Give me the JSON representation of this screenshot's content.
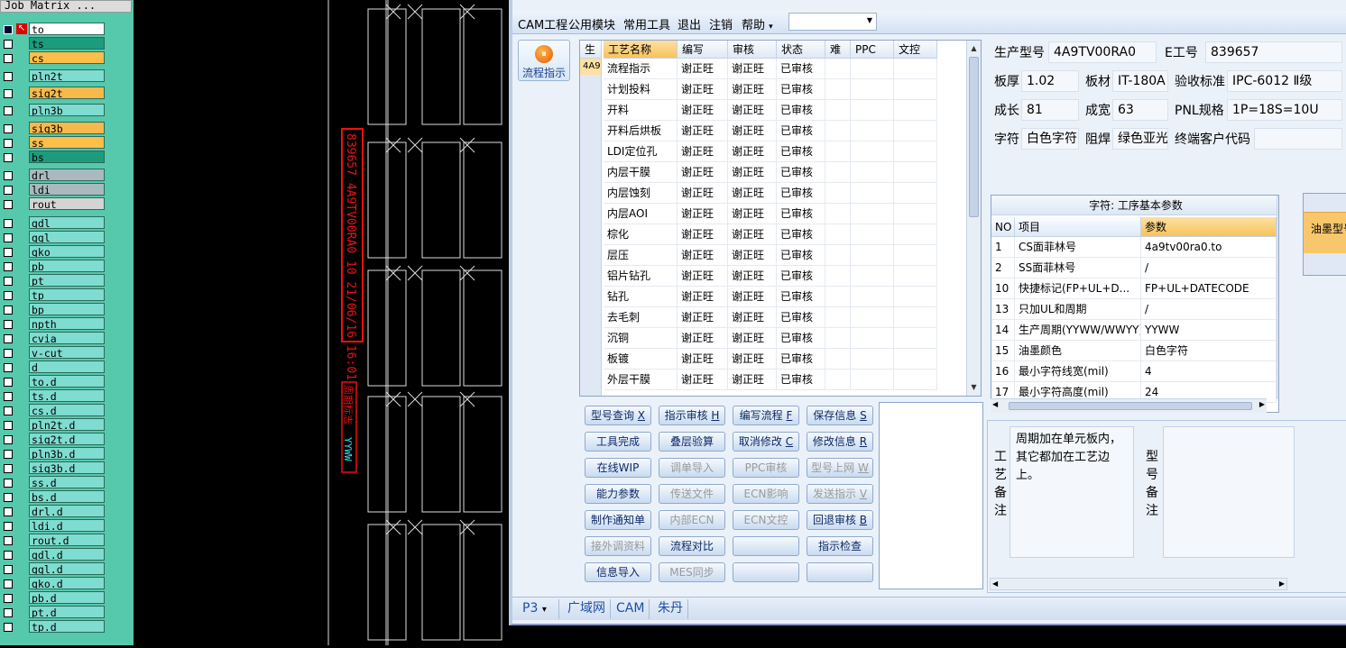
{
  "matrix": {
    "title": "Job Matrix ...",
    "layers": [
      {
        "name": "to",
        "kind": "to"
      },
      {
        "name": "ts",
        "kind": "bs"
      },
      {
        "name": "cs",
        "kind": "cs"
      },
      {
        "name": "pln2t",
        "kind": "misc"
      },
      {
        "name": "sig2t",
        "kind": "sig"
      },
      {
        "name": "pln3b",
        "kind": "misc"
      },
      {
        "name": "sig3b",
        "kind": "sig"
      },
      {
        "name": "ss",
        "kind": "cs"
      },
      {
        "name": "bs",
        "kind": "bs"
      },
      {
        "name": "drl",
        "kind": "drl"
      },
      {
        "name": "ldi",
        "kind": "drl"
      },
      {
        "name": "rout",
        "kind": "rout"
      },
      {
        "name": "gdl",
        "kind": "misc"
      },
      {
        "name": "ggl",
        "kind": "misc"
      },
      {
        "name": "gko",
        "kind": "misc"
      },
      {
        "name": "pb",
        "kind": "misc"
      },
      {
        "name": "pt",
        "kind": "misc"
      },
      {
        "name": "tp",
        "kind": "misc"
      },
      {
        "name": "bp",
        "kind": "misc"
      },
      {
        "name": "npth",
        "kind": "misc"
      },
      {
        "name": "cvia",
        "kind": "misc"
      },
      {
        "name": "v-cut",
        "kind": "misc"
      },
      {
        "name": "d",
        "kind": "misc"
      },
      {
        "name": "to.d",
        "kind": "misc"
      },
      {
        "name": "ts.d",
        "kind": "misc"
      },
      {
        "name": "cs.d",
        "kind": "misc"
      },
      {
        "name": "pln2t.d",
        "kind": "misc"
      },
      {
        "name": "sig2t.d",
        "kind": "misc"
      },
      {
        "name": "pln3b.d",
        "kind": "misc"
      },
      {
        "name": "sig3b.d",
        "kind": "misc"
      },
      {
        "name": "ss.d",
        "kind": "misc"
      },
      {
        "name": "bs.d",
        "kind": "misc"
      },
      {
        "name": "drl.d",
        "kind": "misc"
      },
      {
        "name": "ldi.d",
        "kind": "misc"
      },
      {
        "name": "rout.d",
        "kind": "misc"
      },
      {
        "name": "gdl.d",
        "kind": "misc"
      },
      {
        "name": "ggl.d",
        "kind": "misc"
      },
      {
        "name": "gko.d",
        "kind": "misc"
      },
      {
        "name": "pb.d",
        "kind": "misc"
      },
      {
        "name": "pt.d",
        "kind": "misc"
      },
      {
        "name": "tp.d",
        "kind": "misc"
      }
    ],
    "colors": {
      "misc": "#7fdcd0",
      "sig": "#f7b94b",
      "cs": "#fbbf4a",
      "bs": "#1c9c7c",
      "drl": "#a9b9bf",
      "rout": "#d4d4d4",
      "to": "#ffffff"
    }
  },
  "cad": {
    "code_text": "839657 4A9TV00RA0 10 21/06/16 16:01",
    "cyan_text": "YYWW",
    "red_label": "周期标志",
    "stroke": "#e11",
    "cyan": "#2ee8f4"
  },
  "menu": {
    "items": [
      "CAM工程",
      "公用模块",
      "常用工具",
      "退出",
      "注销",
      "帮助"
    ],
    "help_arrow": "▾",
    "combo_value": ""
  },
  "flow_button": {
    "label": "流程指示"
  },
  "process_grid": {
    "left_header": "生",
    "left_cell": "4A9",
    "columns": [
      "工艺名称",
      "编写",
      "审核",
      "状态",
      "难",
      "PPC",
      "文控"
    ],
    "rows": [
      [
        "流程指示",
        "谢正旺",
        "谢正旺",
        "已审核",
        "",
        "",
        ""
      ],
      [
        "计划投料",
        "谢正旺",
        "谢正旺",
        "已审核",
        "",
        "",
        ""
      ],
      [
        "开料",
        "谢正旺",
        "谢正旺",
        "已审核",
        "",
        "",
        ""
      ],
      [
        "开料后烘板",
        "谢正旺",
        "谢正旺",
        "已审核",
        "",
        "",
        ""
      ],
      [
        "LDI定位孔",
        "谢正旺",
        "谢正旺",
        "已审核",
        "",
        "",
        ""
      ],
      [
        "内层干膜",
        "谢正旺",
        "谢正旺",
        "已审核",
        "",
        "",
        ""
      ],
      [
        "内层蚀刻",
        "谢正旺",
        "谢正旺",
        "已审核",
        "",
        "",
        ""
      ],
      [
        "内层AOI",
        "谢正旺",
        "谢正旺",
        "已审核",
        "",
        "",
        ""
      ],
      [
        "棕化",
        "谢正旺",
        "谢正旺",
        "已审核",
        "",
        "",
        ""
      ],
      [
        "层压",
        "谢正旺",
        "谢正旺",
        "已审核",
        "",
        "",
        ""
      ],
      [
        "铝片钻孔",
        "谢正旺",
        "谢正旺",
        "已审核",
        "",
        "",
        ""
      ],
      [
        "钻孔",
        "谢正旺",
        "谢正旺",
        "已审核",
        "",
        "",
        ""
      ],
      [
        "去毛刺",
        "谢正旺",
        "谢正旺",
        "已审核",
        "",
        "",
        ""
      ],
      [
        "沉铜",
        "谢正旺",
        "谢正旺",
        "已审核",
        "",
        "",
        ""
      ],
      [
        "板镀",
        "谢正旺",
        "谢正旺",
        "已审核",
        "",
        "",
        ""
      ],
      [
        "外层干膜",
        "谢正旺",
        "谢正旺",
        "已审核",
        "",
        "",
        ""
      ]
    ]
  },
  "buttons": [
    [
      {
        "label": "型号查询",
        "key": "X",
        "enabled": true
      },
      {
        "label": "指示审核",
        "key": "H",
        "enabled": true
      },
      {
        "label": "编写流程",
        "key": "F",
        "enabled": true
      },
      {
        "label": "保存信息",
        "key": "S",
        "enabled": true
      }
    ],
    [
      {
        "label": "工具完成",
        "key": "",
        "enabled": true
      },
      {
        "label": "叠层验算",
        "key": "",
        "enabled": true
      },
      {
        "label": "取消修改",
        "key": "C",
        "enabled": true
      },
      {
        "label": "修改信息",
        "key": "R",
        "enabled": true
      }
    ],
    [
      {
        "label": "在线WIP",
        "key": "",
        "enabled": true
      },
      {
        "label": "调单导入",
        "key": "",
        "enabled": false
      },
      {
        "label": "PPC审核",
        "key": "",
        "enabled": false
      },
      {
        "label": "型号上网",
        "key": "W",
        "enabled": false
      }
    ],
    [
      {
        "label": "能力参数",
        "key": "",
        "enabled": true
      },
      {
        "label": "传送文件",
        "key": "",
        "enabled": false
      },
      {
        "label": "ECN影响",
        "key": "",
        "enabled": false
      },
      {
        "label": "发送指示",
        "key": "V",
        "enabled": false
      }
    ],
    [
      {
        "label": "制作通知单",
        "key": "",
        "enabled": true
      },
      {
        "label": "内部ECN",
        "key": "",
        "enabled": false
      },
      {
        "label": "ECN文控",
        "key": "",
        "enabled": false
      },
      {
        "label": "回退审核",
        "key": "B",
        "enabled": true
      }
    ],
    [
      {
        "label": "接外调资料",
        "key": "",
        "enabled": false
      },
      {
        "label": "流程对比",
        "key": "",
        "enabled": true
      },
      {
        "label": "",
        "key": "",
        "enabled": true
      },
      {
        "label": "指示检查",
        "key": "",
        "enabled": true
      }
    ],
    [
      {
        "label": "信息导入",
        "key": "",
        "enabled": true
      },
      {
        "label": "MES同步",
        "key": "",
        "enabled": false
      },
      {
        "label": "",
        "key": "",
        "enabled": true
      },
      {
        "label": "",
        "key": "",
        "enabled": true
      }
    ]
  ],
  "info": {
    "part_no_label": "生产型号",
    "part_no": "4A9TV00RA0",
    "e_no_label": "E工号",
    "e_no": "839657",
    "thickness_label": "板厚",
    "thickness": "1.02",
    "material_label": "板材",
    "material": "IT-180A",
    "standard_label": "验收标准",
    "standard": "IPC-6012 Ⅱ级",
    "length_label": "成长",
    "length": "81",
    "width_label": "成宽",
    "width": "63",
    "pnl_label": "PNL规格",
    "pnl": "1P=18S=10U",
    "legend_label": "字符",
    "legend": "白色字符",
    "mask_label": "阻焊",
    "mask": "绿色亚光",
    "customer_label": "终端客户代码",
    "customer": ""
  },
  "params": {
    "title": "字符: 工序基本参数",
    "columns": [
      "NO",
      "项目",
      "参数"
    ],
    "rows": [
      [
        "1",
        "CS面菲林号",
        "4a9tv00ra0.to"
      ],
      [
        "2",
        "SS面菲林号",
        "/"
      ],
      [
        "10",
        "快捷标记(FP+UL+D...",
        "FP+UL+DATECODE"
      ],
      [
        "13",
        "只加UL和周期",
        "/"
      ],
      [
        "14",
        "生产周期(YYWW/WWYY)",
        "YYWW"
      ],
      [
        "15",
        "油墨颜色",
        "白色字符"
      ],
      [
        "16",
        "最小字符线宽(mil)",
        "4"
      ],
      [
        "17",
        "最小字符高度(mil)",
        "24"
      ]
    ]
  },
  "right_panel": {
    "label": "油墨型号"
  },
  "remarks": {
    "process_label": "工艺备注",
    "process_text": "周期加在单元板内，其它都加在工艺边上。",
    "model_label": "型号备注",
    "model_text": ""
  },
  "statusbar": {
    "items": [
      "P3",
      "广域网",
      "CAM",
      "朱丹"
    ],
    "arrow": "▾"
  }
}
